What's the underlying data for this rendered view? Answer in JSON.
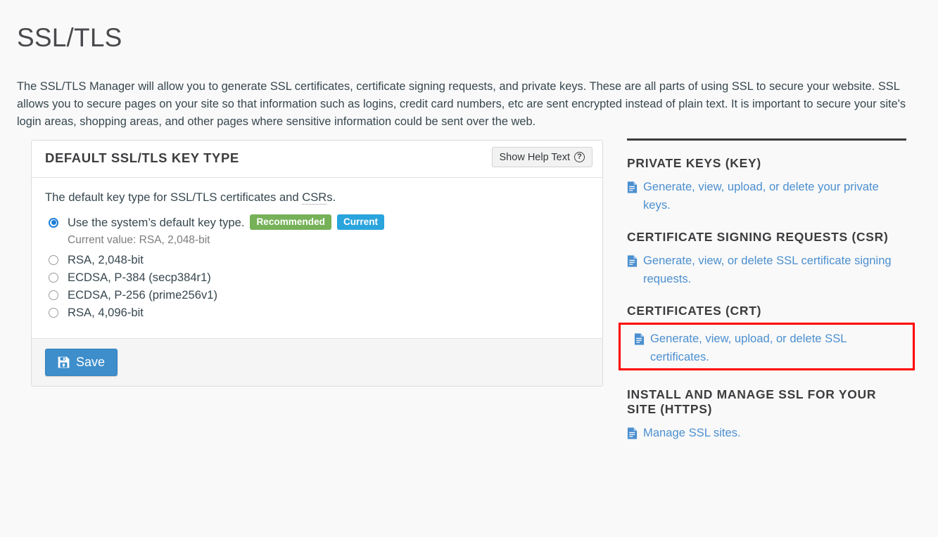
{
  "page": {
    "title": "SSL/TLS",
    "intro": "The SSL/TLS Manager will allow you to generate SSL certificates, certificate signing requests, and private keys. These are all parts of using SSL to secure your website. SSL allows you to secure pages on your site so that information such as logins, credit card numbers, etc are sent encrypted instead of plain text. It is important to secure your site's login areas, shopping areas, and other pages where sensitive information could be sent over the web."
  },
  "panel": {
    "title": "DEFAULT SSL/TLS KEY TYPE",
    "help_button": {
      "label": "Show Help Text",
      "icon": "question-circle-icon"
    },
    "lead_before_abbr": "The default key type for SSL/TLS certificates and ",
    "lead_abbr": "CSR",
    "lead_after_abbr": "s.",
    "options": [
      {
        "label": "Use the system’s default key type.",
        "selected": true,
        "badges": [
          {
            "text": "Recommended",
            "color": "#76b158"
          },
          {
            "text": "Current",
            "color": "#29a4dd"
          }
        ],
        "sublabel": "Current value: RSA, 2,048-bit"
      },
      {
        "label": "RSA, 2,048-bit",
        "selected": false,
        "badges": [],
        "sublabel": ""
      },
      {
        "label": "ECDSA, P-384 (secp384r1)",
        "selected": false,
        "badges": [],
        "sublabel": ""
      },
      {
        "label": "ECDSA, P-256 (prime256v1)",
        "selected": false,
        "badges": [],
        "sublabel": ""
      },
      {
        "label": "RSA, 4,096-bit",
        "selected": false,
        "badges": [],
        "sublabel": ""
      }
    ],
    "save_button": {
      "label": "Save",
      "icon": "floppy-disk-icon",
      "color": "#3e8ecb"
    }
  },
  "sidebar": {
    "sections": [
      {
        "heading": "PRIVATE KEYS (KEY)",
        "link": "Generate, view, upload, or delete your private keys.",
        "icon": "file-document-icon",
        "highlighted": false
      },
      {
        "heading": "CERTIFICATE SIGNING REQUESTS (CSR)",
        "link": "Generate, view, or delete SSL certificate signing requests.",
        "icon": "file-document-icon",
        "highlighted": false
      },
      {
        "heading": "CERTIFICATES (CRT)",
        "link": "Generate, view, upload, or delete SSL certificates.",
        "icon": "file-document-icon",
        "highlighted": true,
        "highlight_color": "#ff0000"
      },
      {
        "heading": "INSTALL AND MANAGE SSL FOR YOUR SITE (HTTPS)",
        "link": "Manage SSL sites.",
        "icon": "file-document-icon",
        "highlighted": false
      }
    ]
  }
}
